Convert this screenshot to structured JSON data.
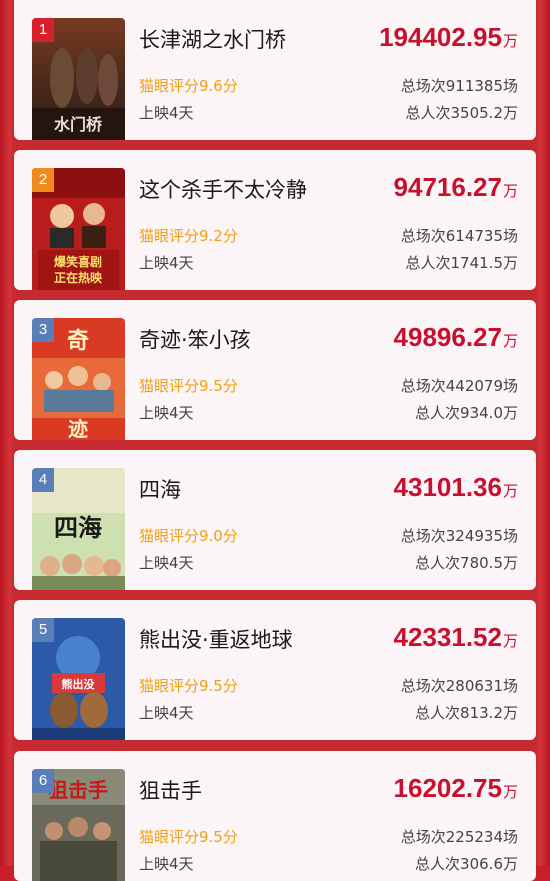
{
  "colors": {
    "background": "#c8202a",
    "card": "#fbf5f7",
    "gross": "#c8102e",
    "score": "#f0a018",
    "rank_top": "#d8202c",
    "rank_other": "#5a7fb8"
  },
  "movies": [
    {
      "rank": "1",
      "title": "长津湖之水门桥",
      "score": "猫眼评分9.6分",
      "days": "上映4天",
      "gross": "194402.95",
      "unit": "万",
      "shows": "总场次911385场",
      "viewers": "总人次3505.2万",
      "poster_text": "水门桥"
    },
    {
      "rank": "2",
      "title": "这个杀手不太冷静",
      "score": "猫眼评分9.2分",
      "days": "上映4天",
      "gross": "94716.27",
      "unit": "万",
      "shows": "总场次614735场",
      "viewers": "总人次1741.5万",
      "poster_text": "爆笑喜剧 正在热映"
    },
    {
      "rank": "3",
      "title": "奇迹·笨小孩",
      "score": "猫眼评分9.5分",
      "days": "上映4天",
      "gross": "49896.27",
      "unit": "万",
      "shows": "总场次442079场",
      "viewers": "总人次934.0万",
      "poster_text": "奇迹"
    },
    {
      "rank": "4",
      "title": "四海",
      "score": "猫眼评分9.0分",
      "days": "上映4天",
      "gross": "43101.36",
      "unit": "万",
      "shows": "总场次324935场",
      "viewers": "总人次780.5万",
      "poster_text": "四海"
    },
    {
      "rank": "5",
      "title": "熊出没·重返地球",
      "score": "猫眼评分9.5分",
      "days": "上映4天",
      "gross": "42331.52",
      "unit": "万",
      "shows": "总场次280631场",
      "viewers": "总人次813.2万",
      "poster_text": "熊出没"
    },
    {
      "rank": "6",
      "title": "狙击手",
      "score": "猫眼评分9.5分",
      "days": "上映4天",
      "gross": "16202.75",
      "unit": "万",
      "shows": "总场次225234场",
      "viewers": "总人次306.6万",
      "poster_text": "狙击手"
    }
  ]
}
